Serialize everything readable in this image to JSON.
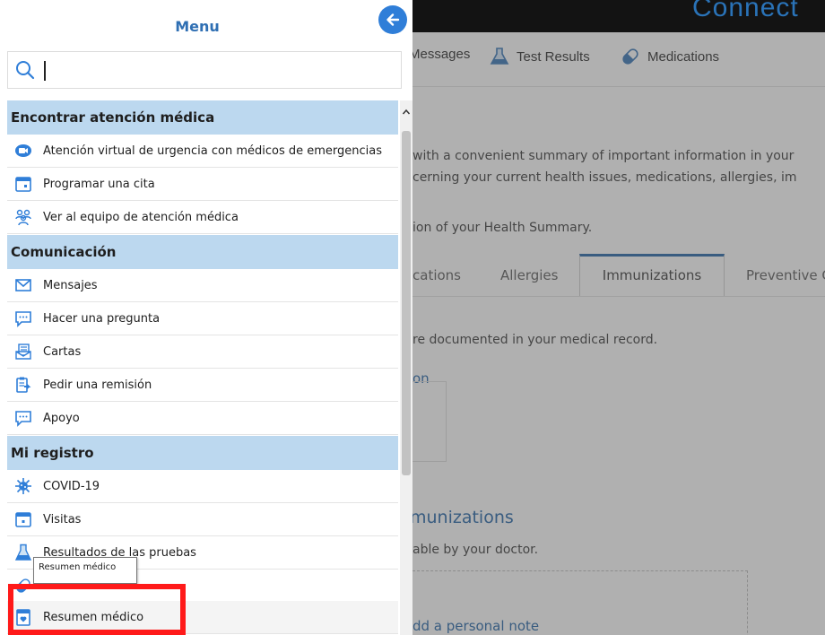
{
  "background": {
    "brand": "Connect",
    "toolbar": [
      {
        "label": "Messages",
        "icon": "envelope-icon"
      },
      {
        "label": "Test Results",
        "icon": "flask-icon"
      },
      {
        "label": "Medications",
        "icon": "pill-icon"
      }
    ],
    "intro_line1": "with a convenient summary of important information in your",
    "intro_line2": "cerning your current health issues, medications, allergies, im",
    "version_line": "ion of your Health Summary.",
    "tabs": [
      "cations",
      "Allergies",
      "Immunizations",
      "Preventive C"
    ],
    "active_tab": "Immunizations",
    "documented_line": "re documented in your medical record.",
    "link_fragment": "on",
    "section_heading": "munizations",
    "sub_line": "able by your doctor.",
    "add_note": "dd a personal note"
  },
  "menu": {
    "title": "Menu",
    "search_placeholder": "",
    "sections": [
      {
        "label": "Encontrar atención médica",
        "items": [
          {
            "label": "Atención virtual de urgencia con médicos de emergencias",
            "icon": "video-visit-icon"
          },
          {
            "label": "Programar una cita",
            "icon": "calendar-icon"
          },
          {
            "label": "Ver al equipo de atención médica",
            "icon": "care-team-icon"
          }
        ]
      },
      {
        "label": "Comunicación",
        "items": [
          {
            "label": "Mensajes",
            "icon": "envelope-icon"
          },
          {
            "label": "Hacer una pregunta",
            "icon": "chat-bubble-icon"
          },
          {
            "label": "Cartas",
            "icon": "letters-icon"
          },
          {
            "label": "Pedir una remisión",
            "icon": "referral-icon"
          },
          {
            "label": "Apoyo",
            "icon": "support-bubble-icon"
          }
        ]
      },
      {
        "label": "Mi registro",
        "items": [
          {
            "label": "COVID-19",
            "icon": "virus-icon"
          },
          {
            "label": "Visitas",
            "icon": "calendar-icon"
          },
          {
            "label": "Resultados de las pruebas",
            "icon": "flask-icon"
          },
          {
            "label": "",
            "icon": "pill-icon"
          },
          {
            "label": "Resumen médico",
            "icon": "health-summary-icon"
          }
        ]
      }
    ],
    "tooltip": "Resumen médico"
  },
  "colors": {
    "accent": "#2f6fb3",
    "section_bg": "#bcd8ef",
    "highlight": "#ff1a1a"
  }
}
